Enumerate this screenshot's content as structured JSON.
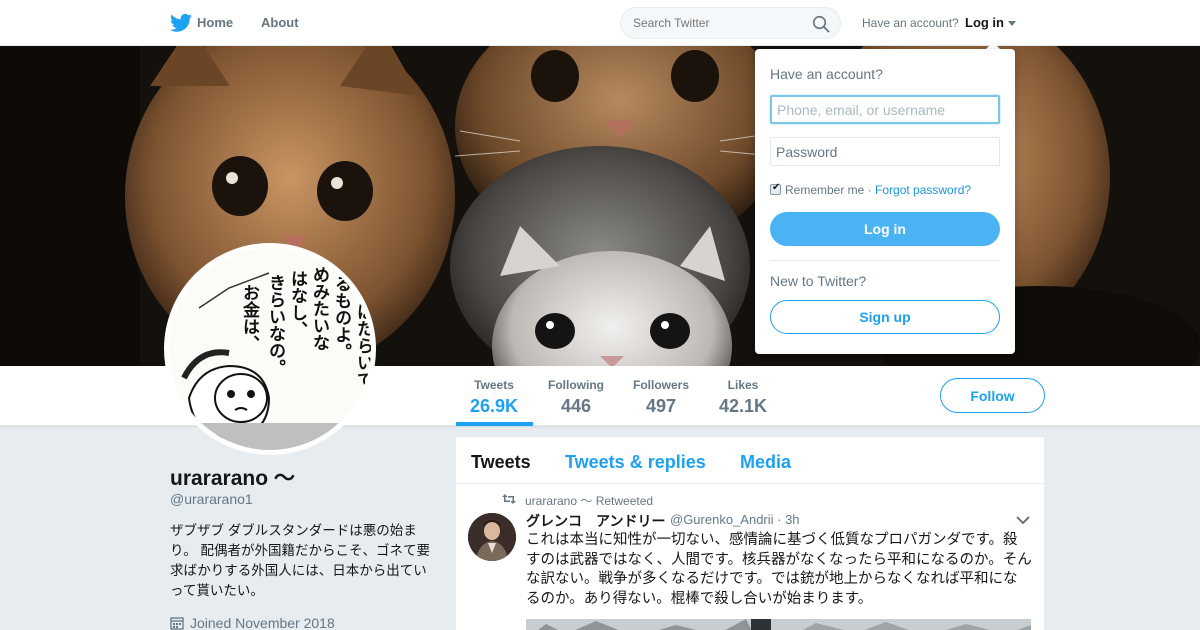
{
  "nav": {
    "home_label": "Home",
    "about_label": "About",
    "search_placeholder": "Search Twitter",
    "have_account": "Have an account?",
    "login_label": "Log in"
  },
  "profile": {
    "name": "urararano 〜",
    "handle": "@urararano1",
    "bio": "ザブザブ ダブルスタンダードは悪の始まり。 配偶者が外国籍だからこそ、ゴネて要求ばかりする外国人には、日本から出ていって貰いたい。",
    "joined": "Joined November 2018"
  },
  "stats": [
    {
      "label": "Tweets",
      "value": "26.9K"
    },
    {
      "label": "Following",
      "value": "446"
    },
    {
      "label": "Followers",
      "value": "497"
    },
    {
      "label": "Likes",
      "value": "42.1K"
    }
  ],
  "follow_label": "Follow",
  "timeline": {
    "tabs": [
      "Tweets",
      "Tweets & replies",
      "Media"
    ],
    "tweet": {
      "retweet_label": "urararano 〜 Retweeted",
      "author_name": "グレンコ　アンドリー",
      "author_handle_time": "@Gurenko_Andrii · 3h",
      "text": "これは本当に知性が一切ない、感情論に基づく低質なプロパガンダです。殺すのは武器ではなく、人間です。核兵器がなくなったら平和になるのか。そんな訳ない。戦争が多くなるだけです。では銃が地上からなくなれば平和になるのか。あり得ない。棍棒で殺し合いが始まります。"
    }
  },
  "login_dropdown": {
    "title": "Have an account?",
    "username_placeholder": "Phone, email, or username",
    "password_placeholder": "Password",
    "remember_label": "Remember me",
    "separator": " · ",
    "forgot_label": "Forgot password?",
    "login_button": "Log in",
    "new_label": "New to Twitter?",
    "signup_button": "Sign up"
  },
  "avatar_manga_text": [
    "お金は、",
    "ぶんではたらいて",
    "するものよ。",
    "めみたいな",
    "はなし、",
    "きらいなの。"
  ],
  "colors": {
    "accent": "#1da1f2",
    "login_button": "#4ab3f4",
    "background": "#e6ecf0"
  }
}
